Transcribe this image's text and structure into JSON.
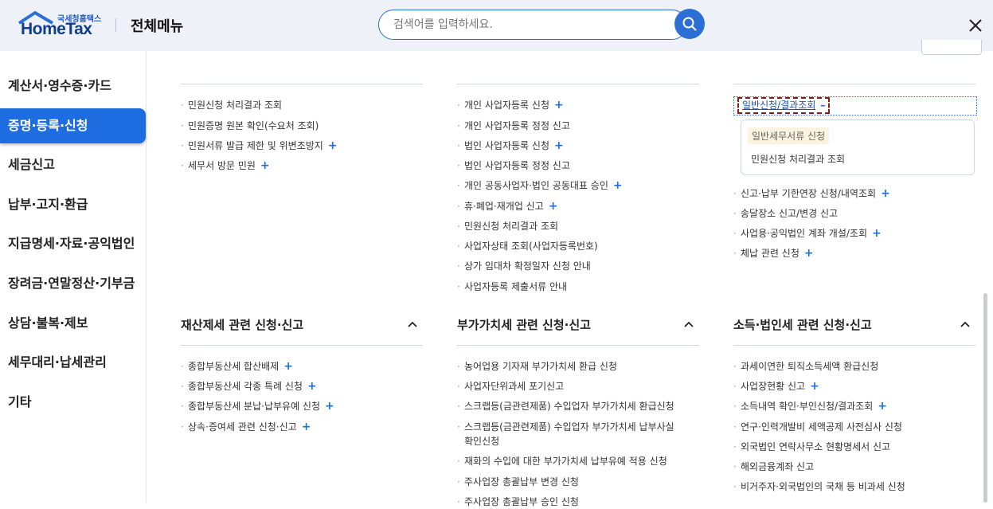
{
  "header": {
    "logo_small": "국세청홈택스",
    "logo_big": "HomeTax",
    "menu_title": "전체메뉴",
    "search_placeholder": "검색어를 입력하세요.",
    "accent_color": "#1d6ce0"
  },
  "sidebar": {
    "items": [
      {
        "label": "계산서·영수증·카드"
      },
      {
        "label": "증명·등록·신청",
        "active": true
      },
      {
        "label": "세금신고"
      },
      {
        "label": "납부·고지·환급"
      },
      {
        "label": "지급명세·자료·공익법인"
      },
      {
        "label": "장려금·연말정산·기부금"
      },
      {
        "label": "상담·불복·제보"
      },
      {
        "label": "세무대리·납세관리"
      },
      {
        "label": "기타"
      }
    ]
  },
  "col1_top": [
    {
      "label": "민원신청 처리결과 조회",
      "plus": false
    },
    {
      "label": "민원증명 원본 확인(수요처 조회)",
      "plus": false
    },
    {
      "label": "민원서류 발급 제한 및 위변조방지",
      "plus": true
    },
    {
      "label": "세무서 방문 민원",
      "plus": true
    }
  ],
  "col2_top": [
    {
      "label": "개인 사업자등록 신청",
      "plus": true
    },
    {
      "label": "개인 사업자등록 정정 신고",
      "plus": false
    },
    {
      "label": "법인 사업자등록 신청",
      "plus": true
    },
    {
      "label": "법인 사업자등록 정정 신고",
      "plus": false
    },
    {
      "label": "개인 공동사업자·법인 공동대표 승인",
      "plus": true
    },
    {
      "label": "휴·폐업·재개업 신고",
      "plus": true
    },
    {
      "label": "민원신청 처리결과 조회",
      "plus": false
    },
    {
      "label": "사업자상태 조회(사업자등록번호)",
      "plus": false
    },
    {
      "label": "상가 임대차 확정일자 신청 안내",
      "plus": false
    },
    {
      "label": "사업자등록 제출서류 안내",
      "plus": false
    }
  ],
  "col3_top": {
    "expanded_label": "일반신청/결과조회",
    "expanded_symbol": "–",
    "sub_tag": "일반세무서류 신청",
    "sub_item": "민원신청 처리결과 조회",
    "items": [
      {
        "label": "신고·납부 기한연장 신청/내역조회",
        "plus": true
      },
      {
        "label": "송달장소 신고/변경 신고",
        "plus": false
      },
      {
        "label": "사업용·공익법인 계좌 개설/조회",
        "plus": true
      },
      {
        "label": "체납 관련 신청",
        "plus": true
      }
    ]
  },
  "plus_symbol": "+",
  "bullet": "·",
  "sections": [
    {
      "title": "재산제세 관련 신청·신고",
      "items": [
        {
          "label": "종합부동산세 합산배제",
          "plus": true
        },
        {
          "label": "종합부동산세 각종 특례 신청",
          "plus": true
        },
        {
          "label": "종합부동산세 분납·납부유예 신청",
          "plus": true
        },
        {
          "label": "상속·증여세 관련 신청·신고",
          "plus": true
        }
      ]
    },
    {
      "title": "부가가치세 관련 신청·신고",
      "items": [
        {
          "label": "농어업용 기자재 부가가치세 환급 신청",
          "plus": false
        },
        {
          "label": "사업자단위과세 포기신고",
          "plus": false
        },
        {
          "label": "스크랩등(금관련제품) 수입업자 부가가치세 환급신청",
          "plus": false
        },
        {
          "label": "스크랩등(금관련제품) 수입업자 부가가치세 납부사실",
          "plus": false
        },
        {
          "label": "확인신청",
          "plus": false
        },
        {
          "label": "재화의 수입에 대한 부가가치세 납부유예 적용 신청",
          "plus": false
        },
        {
          "label": "주사업장 총괄납부 변경 신청",
          "plus": false
        },
        {
          "label": "주사업장 총괄납부 승인 신청",
          "plus": false
        }
      ]
    },
    {
      "title": "소득·법인세 관련 신청·신고",
      "items": [
        {
          "label": "과세이연한 퇴직소득세액 환급신청",
          "plus": false
        },
        {
          "label": "사업장현황 신고",
          "plus": true
        },
        {
          "label": "소득내역 확인·부인신청/결과조회",
          "plus": true
        },
        {
          "label": "연구·인력개발비 세액공제 사전심사 신청",
          "plus": false
        },
        {
          "label": "외국법인 연락사무소 현황명세서 신고",
          "plus": false
        },
        {
          "label": "해외금융계좌 신고",
          "plus": false
        },
        {
          "label": "비거주자·외국법인의 국채 등 비과세 신청",
          "plus": false
        }
      ]
    }
  ]
}
